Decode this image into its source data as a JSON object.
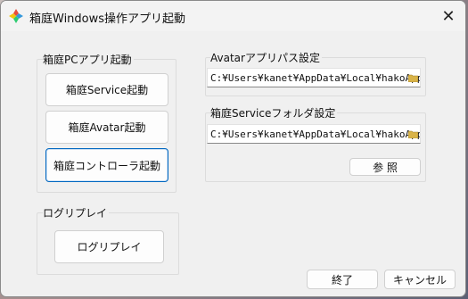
{
  "window": {
    "title": "箱庭Windows操作アプリ起動"
  },
  "pc_group": {
    "label": "箱庭PCアプリ起動",
    "buttons": {
      "service": "箱庭Service起動",
      "avatar": "箱庭Avatar起動",
      "controller": "箱庭コントローラ起動"
    }
  },
  "log_group": {
    "label": "ログリプレイ",
    "replay_button": "ログリプレイ"
  },
  "avatar_group": {
    "label": "Avatarアプリパス設定",
    "path": "C:¥Users¥kanet¥AppData¥Local¥hakoApps-v"
  },
  "service_group": {
    "label": "箱庭Serviceフォルダ設定",
    "path": "C:¥Users¥kanet¥AppData¥Local¥hakoApps-v",
    "browse_button": "参 照"
  },
  "footer": {
    "ok_button": "終了",
    "cancel_button": "キャンセル"
  },
  "colors": {
    "focus_border": "#0067c0",
    "dialog_bg": "#f0f0f0"
  }
}
